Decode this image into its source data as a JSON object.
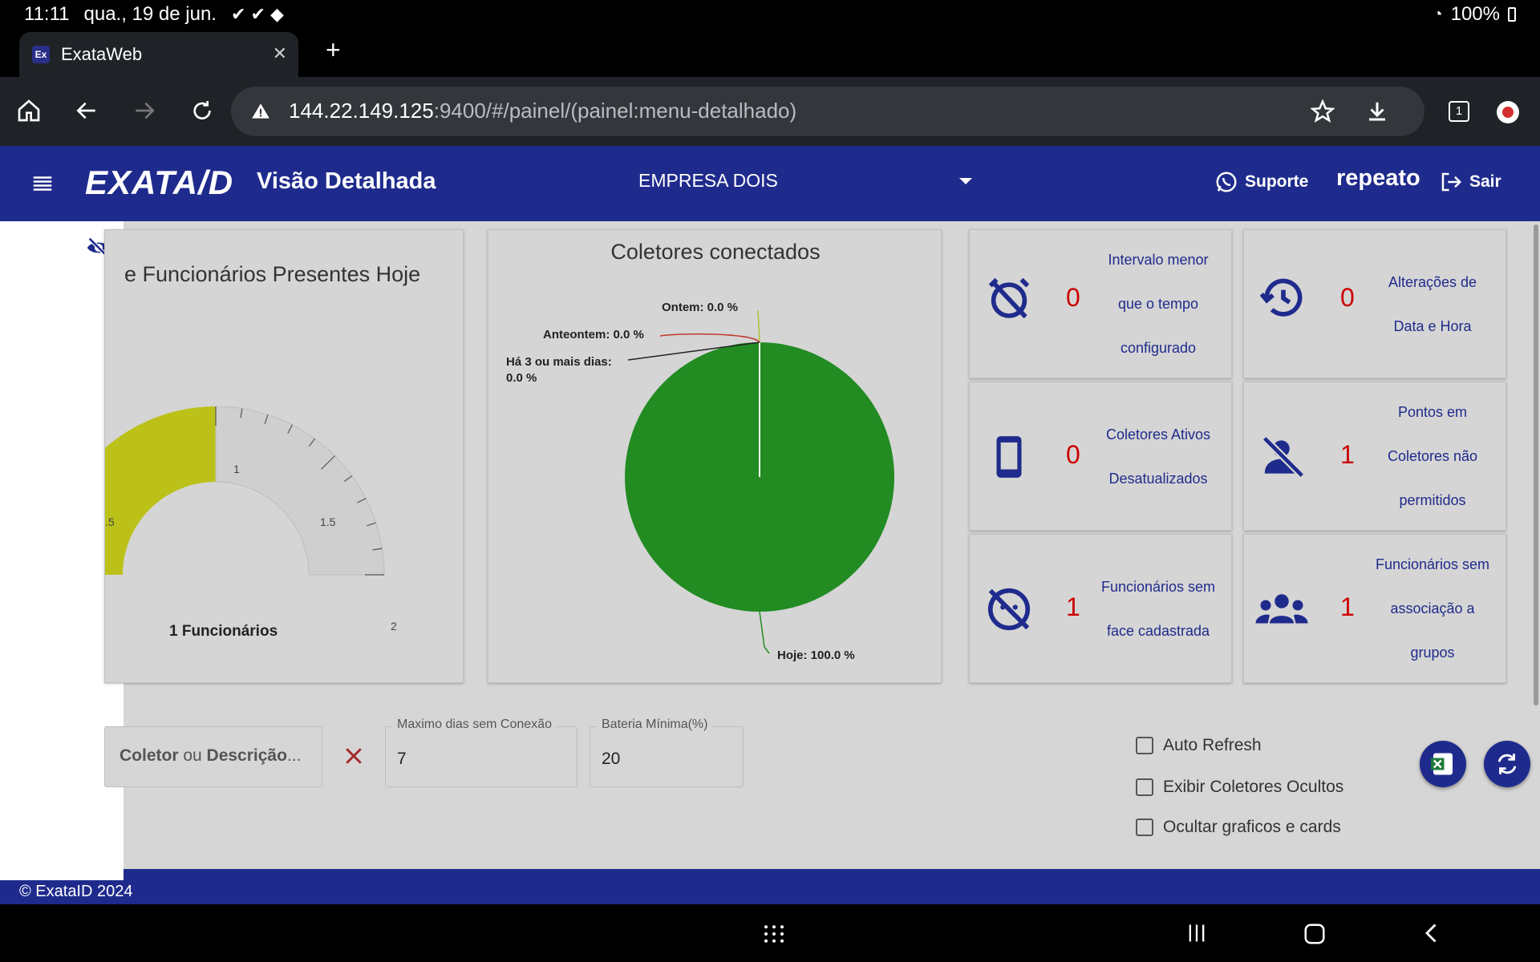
{
  "status_bar": {
    "time": "11:11",
    "date": "qua., 19 de jun.",
    "battery": "100%"
  },
  "browser": {
    "tab_title": "ExataWeb",
    "favicon": "Ex",
    "url_host": "144.22.149.125",
    "url_path": ":9400/#/painel/(painel:menu-detalhado)"
  },
  "header": {
    "logo": "EXATA/D",
    "page_title": "Visão Detalhada",
    "company": "EMPRESA DOIS",
    "support_label": "Suporte",
    "user": "repeato",
    "logout_label": "Sair"
  },
  "gauge_card": {
    "title": "e Funcionários Presentes Hoje",
    "value_label": "1 Funcionários",
    "gauge": {
      "value": 1,
      "min": 0,
      "max": 2,
      "ticks": ".5|1|1.5|2"
    },
    "tick_05": ".5",
    "tick_1": "1",
    "tick_15": "1.5",
    "tick_2": "2",
    "fill_color": "#bcc11a"
  },
  "pie_card": {
    "title": "Coletores conectados",
    "label_ontem": "Ontem: 0.0 %",
    "label_anteontem": "Anteontem: 0.0 %",
    "label_3dias_1": "Há 3 ou mais dias:",
    "label_3dias_2": "0.0 %",
    "label_hoje": "Hoje: 100.0 %",
    "color_hoje": "#228b22"
  },
  "chart_data": {
    "type": "pie",
    "title": "Coletores conectados",
    "categories": [
      "Hoje",
      "Ontem",
      "Anteontem",
      "Há 3 ou mais dias"
    ],
    "values": [
      100.0,
      0.0,
      0.0,
      0.0
    ]
  },
  "cards": [
    {
      "count": "0",
      "l1": "Intervalo menor",
      "l2": "que o tempo",
      "l3": "configurado"
    },
    {
      "count": "0",
      "l1": "Alterações de",
      "l2": "Data e Hora",
      "l3": ""
    },
    {
      "count": "0",
      "l1": "Coletores Ativos",
      "l2": "Desatualizados",
      "l3": ""
    },
    {
      "count": "1",
      "l1": "Pontos em",
      "l2": "Coletores não",
      "l3": "permitidos"
    },
    {
      "count": "1",
      "l1": "Funcionários sem",
      "l2": "face cadastrada",
      "l3": ""
    },
    {
      "count": "1",
      "l1": "Funcionários sem",
      "l2": "associação a",
      "l3": "grupos"
    }
  ],
  "filters": {
    "search_bold1": "Coletor",
    "search_mid": " ou ",
    "search_bold2": "Descrição",
    "search_tail": "...",
    "max_days_label": "Maximo dias sem Conexão",
    "max_days_value": "7",
    "battery_label": "Bateria Mínima(%)",
    "battery_value": "20",
    "auto_refresh": "Auto Refresh",
    "show_hidden": "Exibir Coletores Ocultos",
    "hide_charts": "Ocultar graficos e cards"
  },
  "footer": {
    "copyright": "© ExataID 2024"
  },
  "colors": {
    "brand": "#1f2b8c",
    "alert": "#cc0000",
    "background": "#d6d6d6"
  }
}
